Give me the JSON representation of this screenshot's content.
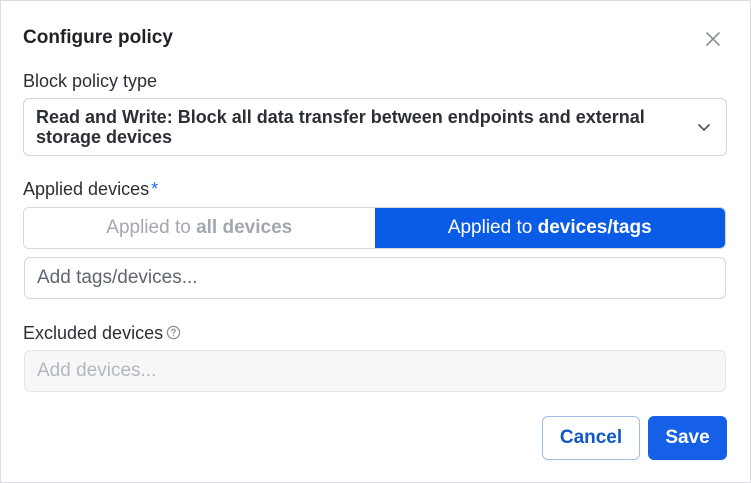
{
  "dialog": {
    "title": "Configure policy",
    "close_icon": "close-icon"
  },
  "policy_type": {
    "label": "Block policy type",
    "selected_value": "Read and Write: Block all data transfer between endpoints and external storage devices",
    "chevron_icon": "chevron-down-icon"
  },
  "applied_devices": {
    "label": "Applied devices",
    "required_marker": "*",
    "options": [
      {
        "prefix": "Applied to ",
        "emphasis": "all devices",
        "selected": false
      },
      {
        "prefix": "Applied to ",
        "emphasis": "devices/tags",
        "selected": true
      }
    ],
    "input_placeholder": "Add tags/devices..."
  },
  "excluded_devices": {
    "label": "Excluded devices",
    "help_icon": "help-icon",
    "input_placeholder": "Add devices..."
  },
  "actions": {
    "cancel_label": "Cancel",
    "save_label": "Save"
  },
  "colors": {
    "accent": "#0a5ce6",
    "primary_button": "#1560e6",
    "required_star": "#1f6fe8"
  }
}
